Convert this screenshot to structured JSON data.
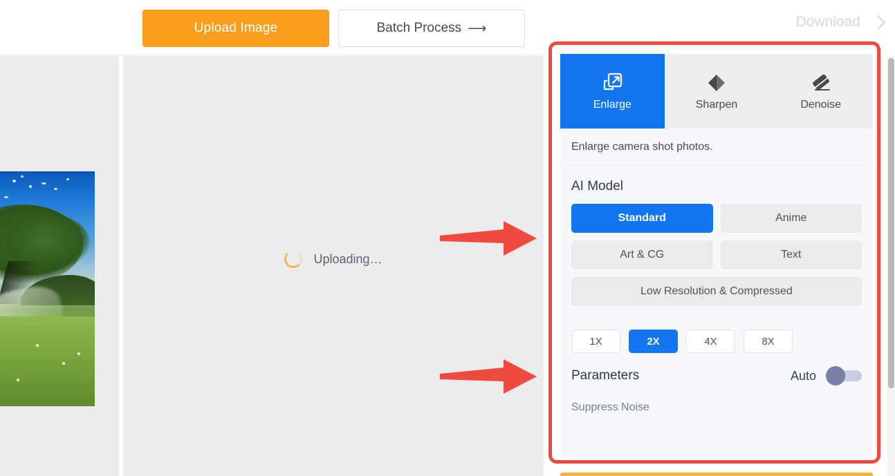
{
  "header": {
    "upload_label": "Upload Image",
    "batch_label": "Batch Process",
    "batch_arrow": "⟶",
    "download_label": "Download"
  },
  "workarea": {
    "uploading_text": "Uploading…",
    "thumbnail_alt": "meadow-with-tree-photo"
  },
  "panel": {
    "tabs": [
      {
        "label": "Enlarge",
        "icon": "enlarge-icon",
        "active": true
      },
      {
        "label": "Sharpen",
        "icon": "sharpen-icon",
        "active": false
      },
      {
        "label": "Denoise",
        "icon": "denoise-icon",
        "active": false
      }
    ],
    "description": "Enlarge camera shot photos.",
    "ai_model": {
      "title": "AI Model",
      "options": [
        {
          "label": "Standard",
          "active": true
        },
        {
          "label": "Anime",
          "active": false
        },
        {
          "label": "Art & CG",
          "active": false
        },
        {
          "label": "Text",
          "active": false
        },
        {
          "label": "Low Resolution & Compressed",
          "active": false
        }
      ]
    },
    "scales": [
      {
        "label": "1X",
        "active": false
      },
      {
        "label": "2X",
        "active": true
      },
      {
        "label": "4X",
        "active": false
      },
      {
        "label": "8X",
        "active": false
      }
    ],
    "parameters": {
      "title": "Parameters",
      "auto_label": "Auto",
      "auto_enabled": false,
      "suppress_noise_label": "Suppress Noise"
    }
  },
  "annotations": {
    "highlight_color": "#ef4a42",
    "arrow_color": "#ef4a42",
    "arrows": [
      {
        "name": "arrow-to-ai-model"
      },
      {
        "name": "arrow-to-scale"
      }
    ]
  },
  "colors": {
    "accent_blue": "#1176f0",
    "accent_orange": "#f99d1c",
    "panel_bg": "#f6f8fb",
    "tab_bg": "#ededed"
  }
}
